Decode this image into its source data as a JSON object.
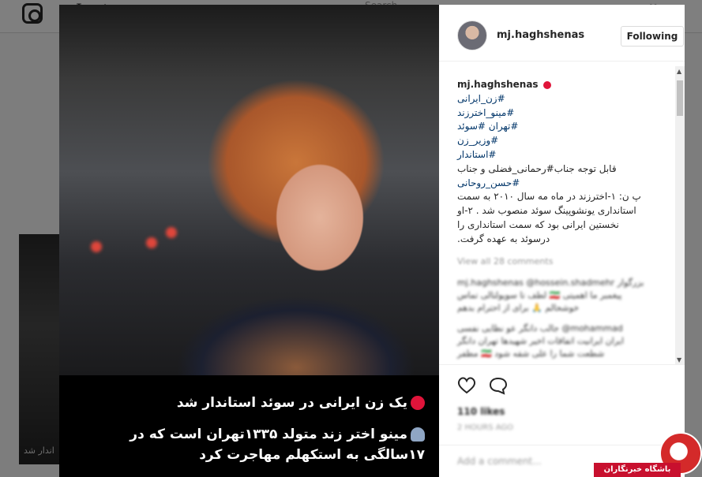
{
  "background": {
    "search_placeholder": "Search",
    "thumb_caption": "اندار شد"
  },
  "post": {
    "photo_caption": {
      "line1": "یک زن ایرانی در سوئد استاندار شد",
      "line2": "مینو اختر زند متولد ۱۳۳۵تهران است که در",
      "line3": "۱۷سالگی به استکهلم مهاجرت کرد"
    },
    "username": "mj.haghshenas",
    "follow_label": "Following",
    "caption": {
      "user": "mj.haghshenas",
      "tags": [
        "#زن_ایرانی",
        "#مینو_اخترزند",
        "#تهران  #سوئد",
        "#وزیر_زن",
        "#استاندار"
      ],
      "attention": "قابل توجه جناب#رحمانی_فضلی و جناب",
      "attention_tag": "#حسن_روحانی",
      "body": [
        "پ ن: ۱-اخترزند در ماه مه سال ۲۰۱۰ به سمت",
        "استانداری یونشوپینگ سوئد منصوب شد . ۲-او",
        "نخستین ایرانی بود که سمت استانداری را",
        "درسوئد به عهده گرفت."
      ]
    },
    "view_all": "View all 28 comments",
    "comments": [
      "mj.haghshenas @hossein.shadmehr بزرگوار",
      "لطف تا سوپولتالی تماس 🇮🇷 پیغمبر ما اهمیتی",
      "خوشحالم 🙏 برای از احترام بدهم",
      "جالب دانگر عو نظایی نفسی @mohammad",
      "ایران ایرانیت اتفاقات اخیر شهیدها تهران دانگر",
      "مطفر 🇮🇷 شطعت شما را علی شقه شود"
    ],
    "likes": "110 likes",
    "time": "2 HOURS AGO",
    "add_comment_placeholder": "Add a comment..."
  },
  "watermark": {
    "text": "باشگاه خبرنگاران"
  }
}
